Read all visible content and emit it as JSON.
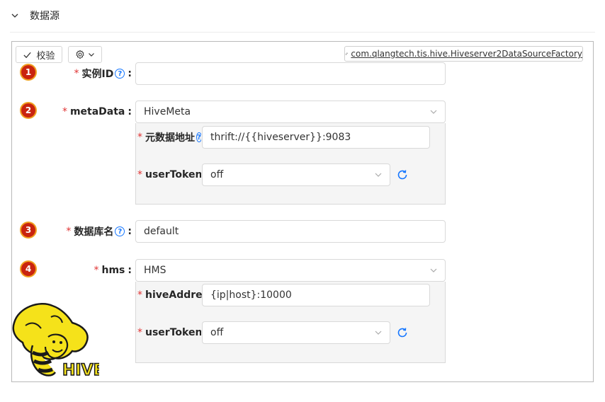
{
  "section": {
    "title": "数据源"
  },
  "toolbar": {
    "verify_label": "校验",
    "factory_class": "com.qlangtech.tis.hive.Hiveserver2DataSourceFactory"
  },
  "badges": [
    "1",
    "2",
    "3",
    "4"
  ],
  "fields": {
    "instance_id": {
      "label": "实例ID",
      "value": ""
    },
    "meta_data": {
      "label": "metaData",
      "value": "HiveMeta",
      "sub": {
        "meta_address": {
          "label": "元数据地址",
          "value": "thrift://{{hiveserver}}:9083"
        },
        "user_token": {
          "label": "userToken",
          "value": "off"
        }
      }
    },
    "db_name": {
      "label": "数据库名",
      "value": "default"
    },
    "hms": {
      "label": "hms",
      "value": "HMS",
      "sub": {
        "hive_address": {
          "label": "hiveAddress",
          "value": "{ip|host}:10000"
        },
        "user_token": {
          "label": "userToken",
          "value": "off"
        }
      }
    }
  },
  "logo": {
    "text": "HIVE",
    "colors": {
      "yellow": "#f5e21a",
      "outline": "#1a1a1a"
    }
  },
  "colors": {
    "required": "#e03434",
    "accent": "#1677ff",
    "badge": "#c9240f"
  }
}
